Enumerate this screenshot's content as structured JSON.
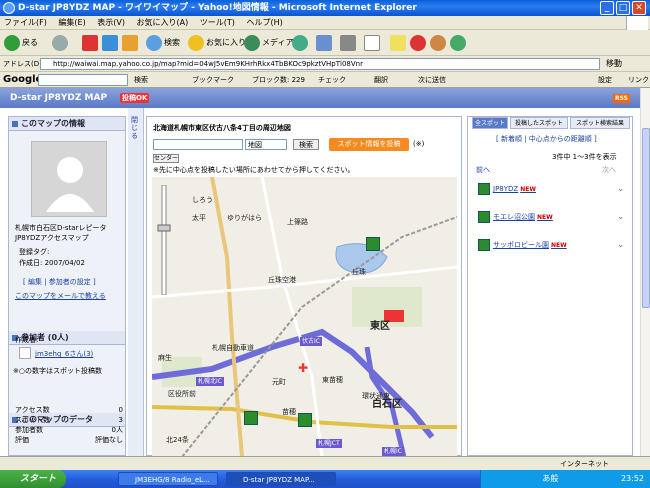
{
  "window": {
    "title": "D-star JP8YDZ MAP - ワイワイマップ - Yahoo!地図情報 - Microsoft Internet Explorer"
  },
  "menu": [
    "ファイル(F)",
    "編集(E)",
    "表示(V)",
    "お気に入り(A)",
    "ツール(T)",
    "ヘルプ(H)"
  ],
  "toolbar": {
    "back": "戻る",
    "search": "検索",
    "favorites": "お気に入り",
    "media": "メディア"
  },
  "address": {
    "label": "アドレス(D)",
    "url": "http://waiwai.map.yahoo.co.jp/map?mid=04wJ5vEm9KHrhRkx4TbBKOc9pkztVHpTl08Vnr",
    "go": "移動"
  },
  "google": {
    "logo": "Google",
    "search_btn": "検索",
    "bookmarks": "ブックマーク",
    "blocked": "ブロック数: 229",
    "check": "チェック",
    "translate": "翻訳",
    "next": "次に送信",
    "settings": "設定",
    "link": "リンク"
  },
  "header": {
    "title": "D-star JP8YDZ MAP",
    "badge": "投稿OK",
    "rss": "RSS"
  },
  "left": {
    "map_info_title": "このマップの情報",
    "description": "札幌市白石区D-starレピータJP8YDZアクセスマップ",
    "tags": "登録タグ:",
    "created": "作成日: 2007/04/02",
    "links": "[ 編集 | 参加者の設定 ]",
    "mail": "このマップをメールで教える",
    "members_title": "参加者 (0人)",
    "creator_label": "作成者:",
    "creator": "jm3ehg_6さん(3)",
    "member_note": "※○の数字はスポット投稿数",
    "data_title": "このマップのデータ",
    "stats": [
      {
        "k": "アクセス数",
        "v": "0"
      },
      {
        "k": "スポット数",
        "v": "3"
      },
      {
        "k": "参加者数",
        "v": "0人"
      },
      {
        "k": "評価",
        "v": "評価なし"
      }
    ]
  },
  "collapse": "閉じる",
  "mapcol": {
    "title": "北海道札幌市東区伏古八条4丁目の周辺地図",
    "type_select": "地図",
    "search_btn": "検索",
    "post_btn": "スポット情報を投稿",
    "post_note": "(※)",
    "center_btn": "センター",
    "note": "※先に中心点を投稿したい場所にあわせてから押してください。"
  },
  "map_labels": [
    {
      "t": "しろう"
    },
    {
      "t": "ゆりがはら"
    },
    {
      "t": "太平"
    },
    {
      "t": "上篠路"
    },
    {
      "t": "丘珠"
    },
    {
      "t": "丘珠空港"
    },
    {
      "t": "東区"
    },
    {
      "t": "札幌自動車道"
    },
    {
      "t": "伏古IC"
    },
    {
      "t": "札幌北IC"
    },
    {
      "t": "元町"
    },
    {
      "t": "東苗穂"
    },
    {
      "t": "苗穂"
    },
    {
      "t": "環状通東"
    },
    {
      "t": "札幌JCT"
    },
    {
      "t": "札幌IC"
    },
    {
      "t": "白石区"
    },
    {
      "t": "麻生"
    },
    {
      "t": "区役所前"
    },
    {
      "t": "北24条"
    }
  ],
  "right": {
    "tabs": [
      "全スポット",
      "投稿したスポット",
      "スポット検索結果"
    ],
    "sort": "[ 新着順 | 中心点からの距離順 ]",
    "count": "3件中 1～3件を表示",
    "prev": "前へ",
    "next": "次へ",
    "spots": [
      {
        "name": "JP8YDZ",
        "new": "NEW"
      },
      {
        "name": "モエレ沼公園",
        "new": "NEW"
      },
      {
        "name": "サッポロビール園",
        "new": "NEW"
      }
    ]
  },
  "status": {
    "text": "",
    "zone": "インターネット"
  },
  "taskbar": {
    "start": "スタート",
    "tasks": [
      "JM3EHG/8 Radio_eL...",
      "D-star JP8YDZ MAP..."
    ],
    "ime": "あ般",
    "time": "23:52"
  }
}
